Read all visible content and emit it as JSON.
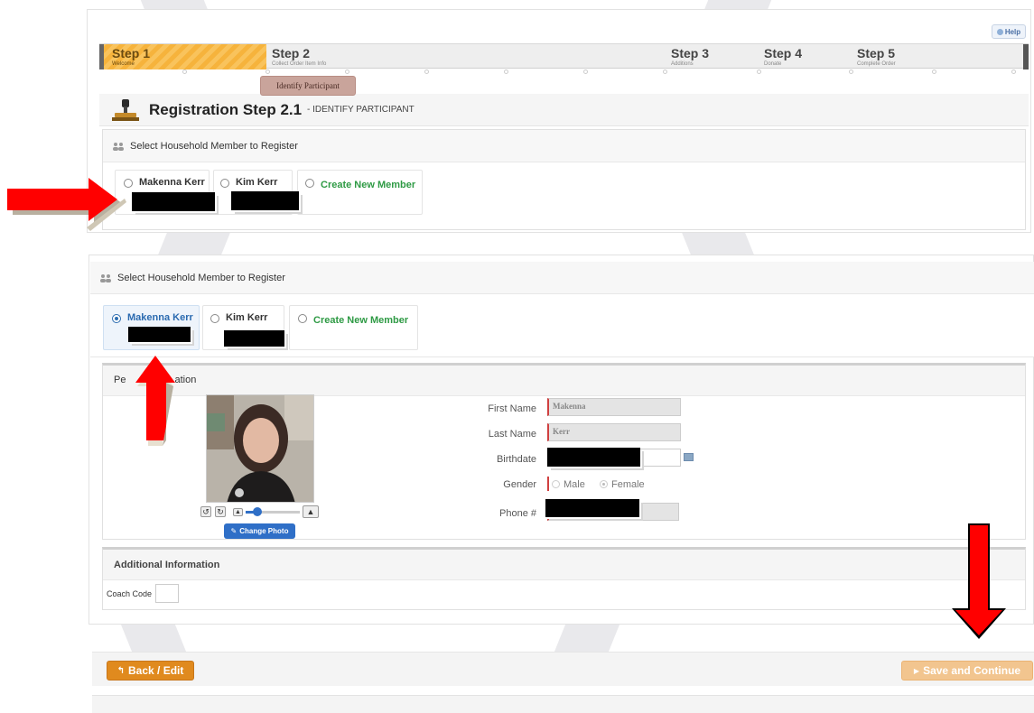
{
  "top": {
    "help_label": "Help",
    "steps": [
      {
        "title": "Step 1",
        "sub": "Welcome"
      },
      {
        "title": "Step 2",
        "sub": "Collect Order Item Info"
      },
      {
        "title": "Step 3",
        "sub": "Additions"
      },
      {
        "title": "Step 4",
        "sub": "Donate"
      },
      {
        "title": "Step 5",
        "sub": "Complete Order"
      }
    ],
    "sub_tab": "Identify Participant",
    "registration_title": "Registration Step 2.1",
    "registration_sub": "- IDENTIFY PARTICIPANT",
    "section_title": "Select Household Member to Register",
    "members": [
      {
        "name": "Makenna Kerr",
        "selected": false
      },
      {
        "name": "Kim Kerr",
        "selected": false
      },
      {
        "name": "Create New Member",
        "selected": false
      }
    ]
  },
  "bottom": {
    "section_title": "Select Household Member to Register",
    "members": [
      {
        "name": "Makenna Kerr",
        "selected": true
      },
      {
        "name": "Kim Kerr",
        "selected": false
      },
      {
        "name": "Create New Member",
        "selected": false
      }
    ],
    "personal_title_left": "Pe",
    "personal_title_right": "ation",
    "change_photo_label": "Change Photo",
    "fields": {
      "first_name_label": "First Name",
      "first_name_value": "Makenna",
      "last_name_label": "Last Name",
      "last_name_value": "Kerr",
      "birthdate_label": "Birthdate",
      "gender_label": "Gender",
      "gender_male": "Male",
      "gender_female": "Female",
      "gender_selected": "Female",
      "phone_label": "Phone #"
    },
    "additional_title": "Additional Information",
    "coach_code_label": "Coach Code"
  },
  "footer": {
    "back_label": "Back / Edit",
    "save_label": "Save and Continue"
  },
  "colors": {
    "step_active": "#f6b33c",
    "back_button": "#e08a1e",
    "save_button": "#f2c58f",
    "change_photo": "#2f6fc7",
    "create_member": "#2e9a44",
    "arrow": "#ff0000"
  }
}
